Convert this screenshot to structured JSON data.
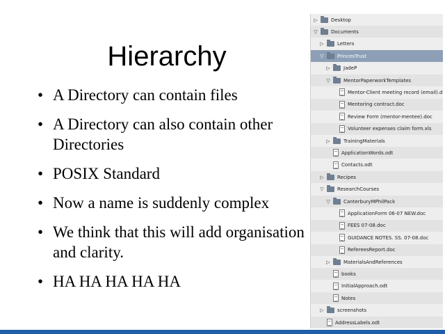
{
  "slide": {
    "title": "Hierarchy",
    "bullets": [
      "A Directory can contain files",
      "A Directory can also contain other Directories",
      "POSIX Standard",
      "Now a name is suddenly complex",
      "We think that this will add organisation and clarity.",
      "HA HA HA HA HA"
    ]
  },
  "tree": {
    "rows": [
      {
        "label": "Desktop",
        "kind": "folder",
        "level": 0,
        "twisty": "▷"
      },
      {
        "label": "Documents",
        "kind": "folder",
        "level": 0,
        "twisty": "▽"
      },
      {
        "label": "Letters",
        "kind": "folder",
        "level": 1,
        "twisty": "▷"
      },
      {
        "label": "PrincesTrust",
        "kind": "folder",
        "level": 1,
        "twisty": "▽",
        "selected": true
      },
      {
        "label": "JadeP",
        "kind": "folder",
        "level": 2,
        "twisty": "▷"
      },
      {
        "label": "MentorPaperworkTemplates",
        "kind": "folder",
        "level": 2,
        "twisty": "▽"
      },
      {
        "label": "Mentor-Client meeting record (email).doc",
        "kind": "doc",
        "level": 3,
        "twisty": ""
      },
      {
        "label": "Mentoring contract.doc",
        "kind": "doc",
        "level": 3,
        "twisty": ""
      },
      {
        "label": "Review Form (mentor-mentee).doc",
        "kind": "doc",
        "level": 3,
        "twisty": ""
      },
      {
        "label": "Volunteer expenses claim form.xls",
        "kind": "doc",
        "level": 3,
        "twisty": ""
      },
      {
        "label": "TrainingMaterials",
        "kind": "folder",
        "level": 2,
        "twisty": "▷"
      },
      {
        "label": "ApplicationWords.odt",
        "kind": "doc",
        "level": 2,
        "twisty": ""
      },
      {
        "label": "Contacts.odt",
        "kind": "doc",
        "level": 2,
        "twisty": ""
      },
      {
        "label": "Recipes",
        "kind": "folder",
        "level": 1,
        "twisty": "▷"
      },
      {
        "label": "ResearchCourses",
        "kind": "folder",
        "level": 1,
        "twisty": "▽"
      },
      {
        "label": "CanterburyMPhilPack",
        "kind": "folder",
        "level": 2,
        "twisty": "▽"
      },
      {
        "label": "ApplicationForm 06-07 NEW.doc",
        "kind": "doc",
        "level": 3,
        "twisty": ""
      },
      {
        "label": "FEES 07-08.doc",
        "kind": "doc",
        "level": 3,
        "twisty": ""
      },
      {
        "label": "GUIDANCE NOTES. SS. 07-08.doc",
        "kind": "doc",
        "level": 3,
        "twisty": ""
      },
      {
        "label": "RefereesReport.doc",
        "kind": "doc",
        "level": 3,
        "twisty": ""
      },
      {
        "label": "MaterialsAndReferences",
        "kind": "folder",
        "level": 2,
        "twisty": "▷"
      },
      {
        "label": "books",
        "kind": "doc",
        "level": 2,
        "twisty": ""
      },
      {
        "label": "InitialApproach.odt",
        "kind": "doc",
        "level": 2,
        "twisty": ""
      },
      {
        "label": "Notes",
        "kind": "doc",
        "level": 2,
        "twisty": ""
      },
      {
        "label": "screenshots",
        "kind": "folder",
        "level": 1,
        "twisty": "▷"
      },
      {
        "label": "AddressLabels.odt",
        "kind": "doc",
        "level": 1,
        "twisty": ""
      }
    ]
  }
}
